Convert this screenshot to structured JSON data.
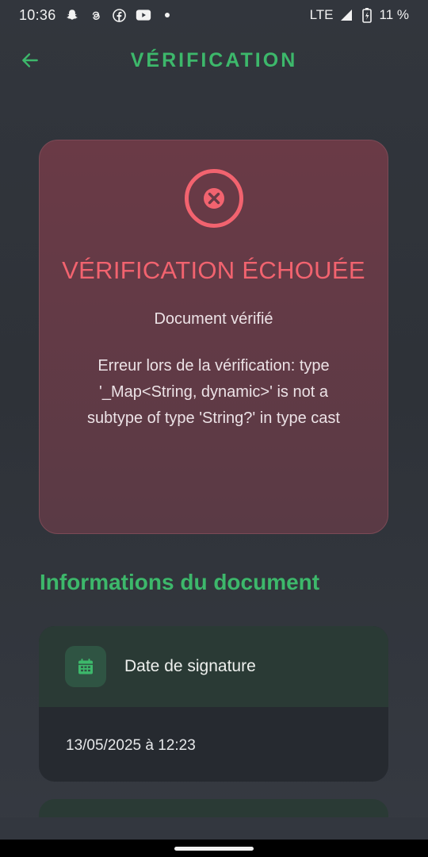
{
  "status_bar": {
    "time": "10:36",
    "network": "LTE",
    "battery": "11 %",
    "icons": [
      "snapchat-icon",
      "threads-icon",
      "facebook-icon",
      "youtube-icon",
      "dot-icon",
      "signal-icon",
      "battery-charging-icon"
    ]
  },
  "appbar": {
    "title": "VÉRIFICATION",
    "back_icon": "arrow-left-icon"
  },
  "colors": {
    "accent": "#3db86b",
    "error": "#f2636f",
    "error_card_bg": "#6a3a46",
    "background": "#30343b"
  },
  "result": {
    "icon": "error-circle-x-icon",
    "title": "VÉRIFICATION ÉCHOUÉE",
    "subtitle": "Document vérifié",
    "message": "Erreur lors de la vérification: type '_Map<String, dynamic>' is not a subtype of type 'String?' in type cast"
  },
  "section": {
    "title": "Informations du document"
  },
  "info": {
    "icon": "calendar-icon",
    "label": "Date de signature",
    "value": "13/05/2025 à 12:23"
  }
}
